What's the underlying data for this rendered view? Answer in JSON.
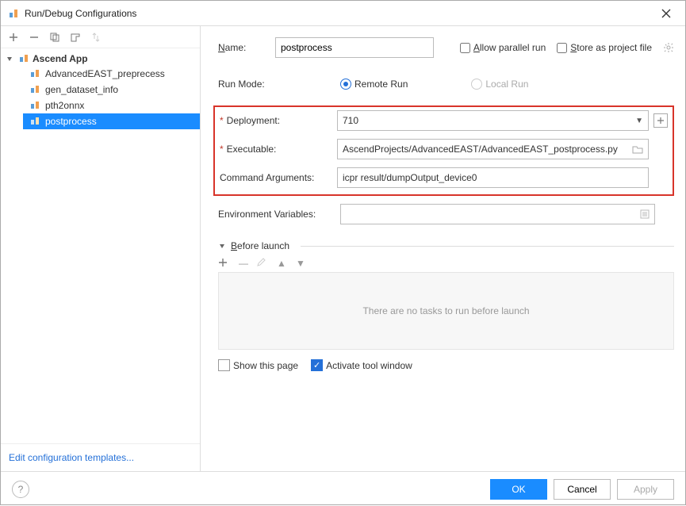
{
  "window": {
    "title": "Run/Debug Configurations"
  },
  "tree": {
    "root_label": "Ascend App",
    "items": [
      {
        "label": "AdvancedEAST_preprecess"
      },
      {
        "label": "gen_dataset_info"
      },
      {
        "label": "pth2onnx"
      },
      {
        "label": "postprocess"
      }
    ]
  },
  "templates_link": "Edit configuration templates...",
  "form": {
    "name_label_pre": "N",
    "name_label_rest": "ame:",
    "name_value": "postprocess",
    "allow_parallel": "Allow parallel run",
    "store_project": "Store as project file",
    "run_mode_label": "Run Mode:",
    "remote_run": "Remote Run",
    "local_run": "Local Run",
    "deployment_label": "Deployment:",
    "deployment_value": "710",
    "executable_label": "Executable:",
    "executable_value": "AscendProjects/AdvancedEAST/AdvancedEAST_postprocess.py",
    "cmd_args_label": "Command Arguments:",
    "cmd_args_value": "icpr result/dumpOutput_device0",
    "env_vars_label": "Environment Variables:",
    "env_vars_value": ""
  },
  "before_launch": {
    "header_pre": "B",
    "header_rest": "efore launch",
    "empty_text": "There are no tasks to run before launch",
    "show_page": "Show this page",
    "activate_tool": "Activate tool window"
  },
  "footer": {
    "ok": "OK",
    "cancel": "Cancel",
    "apply": "Apply"
  }
}
